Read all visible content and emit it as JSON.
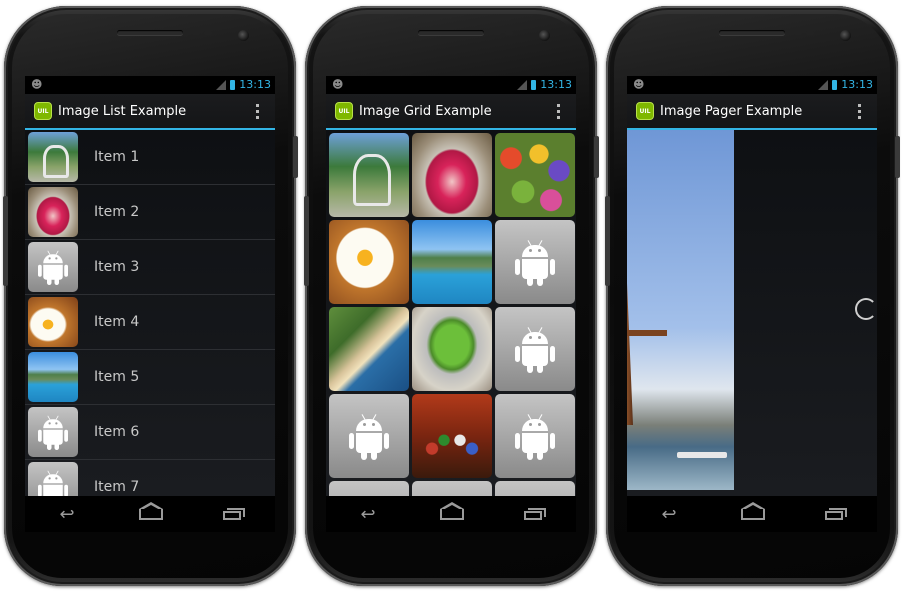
{
  "status": {
    "time": "13:13"
  },
  "phones": [
    {
      "title": "Image List Example",
      "items": [
        "Item 1",
        "Item 2",
        "Item 3",
        "Item 4",
        "Item 5",
        "Item 6",
        "Item 7"
      ]
    },
    {
      "title": "Image Grid Example"
    },
    {
      "title": "Image Pager Example"
    }
  ],
  "app_icon_label": "UIL",
  "nav": {
    "back": "↩"
  },
  "colors": {
    "accent": "#33b5e5",
    "background": "#0e0f11"
  },
  "icons": [
    "android-status-icon",
    "signal-icon",
    "battery-icon",
    "overflow-menu-icon",
    "back-icon",
    "home-icon",
    "recent-apps-icon",
    "loading-spinner-icon",
    "android-placeholder-icon"
  ]
}
